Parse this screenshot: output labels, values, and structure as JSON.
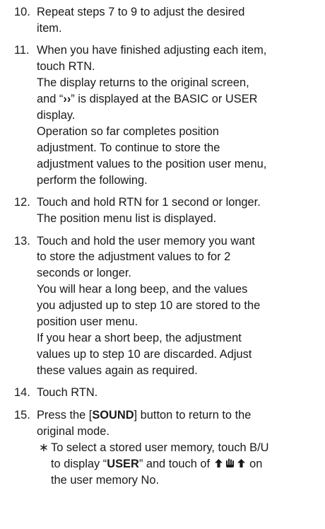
{
  "steps": {
    "s10": {
      "number": "10.",
      "lines": [
        "Repeat steps 7 to 9 to adjust the desired",
        "item."
      ]
    },
    "s11": {
      "number": "11.",
      "lines": [
        "When you have finished adjusting each item,",
        "touch RTN.",
        "The display returns to the original screen,",
        "and “",
        "››",
        "” is displayed at the BASIC or USER",
        "display.",
        "Operation so far completes position",
        "adjustment. To continue to store the",
        "adjustment values to the position user menu,",
        "perform the following."
      ]
    },
    "s12": {
      "number": "12.",
      "lines": [
        "Touch and hold RTN for 1 second or longer.",
        "The position menu list is displayed."
      ]
    },
    "s13": {
      "number": "13.",
      "lines": [
        "Touch and hold the user memory you want",
        "to store the adjustment values to for 2",
        "seconds or longer.",
        "You will hear a long beep, and the values",
        "you adjusted up to step 10 are stored to the",
        "position user menu.",
        "If you hear a short beep, the adjustment",
        "values up to step 10 are discarded. Adjust",
        "these values again as required."
      ]
    },
    "s14": {
      "number": "14.",
      "lines": [
        "Touch RTN."
      ]
    },
    "s15": {
      "number": "15.",
      "lines": [
        "Press the [",
        "SOUND",
        "] button to return to the",
        "original mode."
      ],
      "note": {
        "marker": "∗",
        "line1": "To select a stored user memory, touch B/U",
        "line2_a": "to display “",
        "line2_b": "USER",
        "line2_c": "” and touch of",
        "line2_d": "on",
        "line3": "the user memory No."
      }
    }
  },
  "icons": [
    "arrow-up-icon",
    "hand-touch-icon",
    "arrow-up-icon"
  ]
}
